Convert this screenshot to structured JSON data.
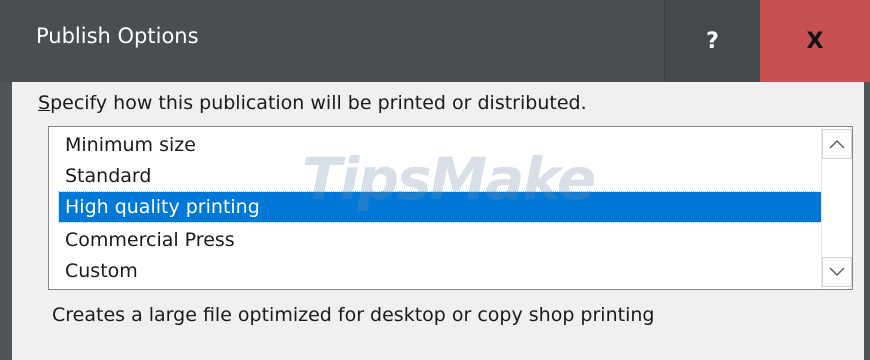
{
  "window": {
    "title": "Publish Options",
    "help_label": "?",
    "close_label": "X"
  },
  "prompt": {
    "accesskey": "S",
    "rest": "pecify how this publication will be printed or distributed."
  },
  "options": [
    {
      "label": "Minimum size",
      "selected": false
    },
    {
      "label": "Standard",
      "selected": false
    },
    {
      "label": "High quality printing",
      "selected": true
    },
    {
      "label": "Commercial Press",
      "selected": false
    },
    {
      "label": "Custom",
      "selected": false
    }
  ],
  "description": "Creates a large file optimized for desktop or copy shop printing",
  "watermark": "TipsMake",
  "colors": {
    "titlebar": "#4a4e52",
    "close": "#c75050",
    "selection": "#0078d7"
  },
  "icons": {
    "scroll_up": "chevron-up-icon",
    "scroll_down": "chevron-down-icon"
  }
}
